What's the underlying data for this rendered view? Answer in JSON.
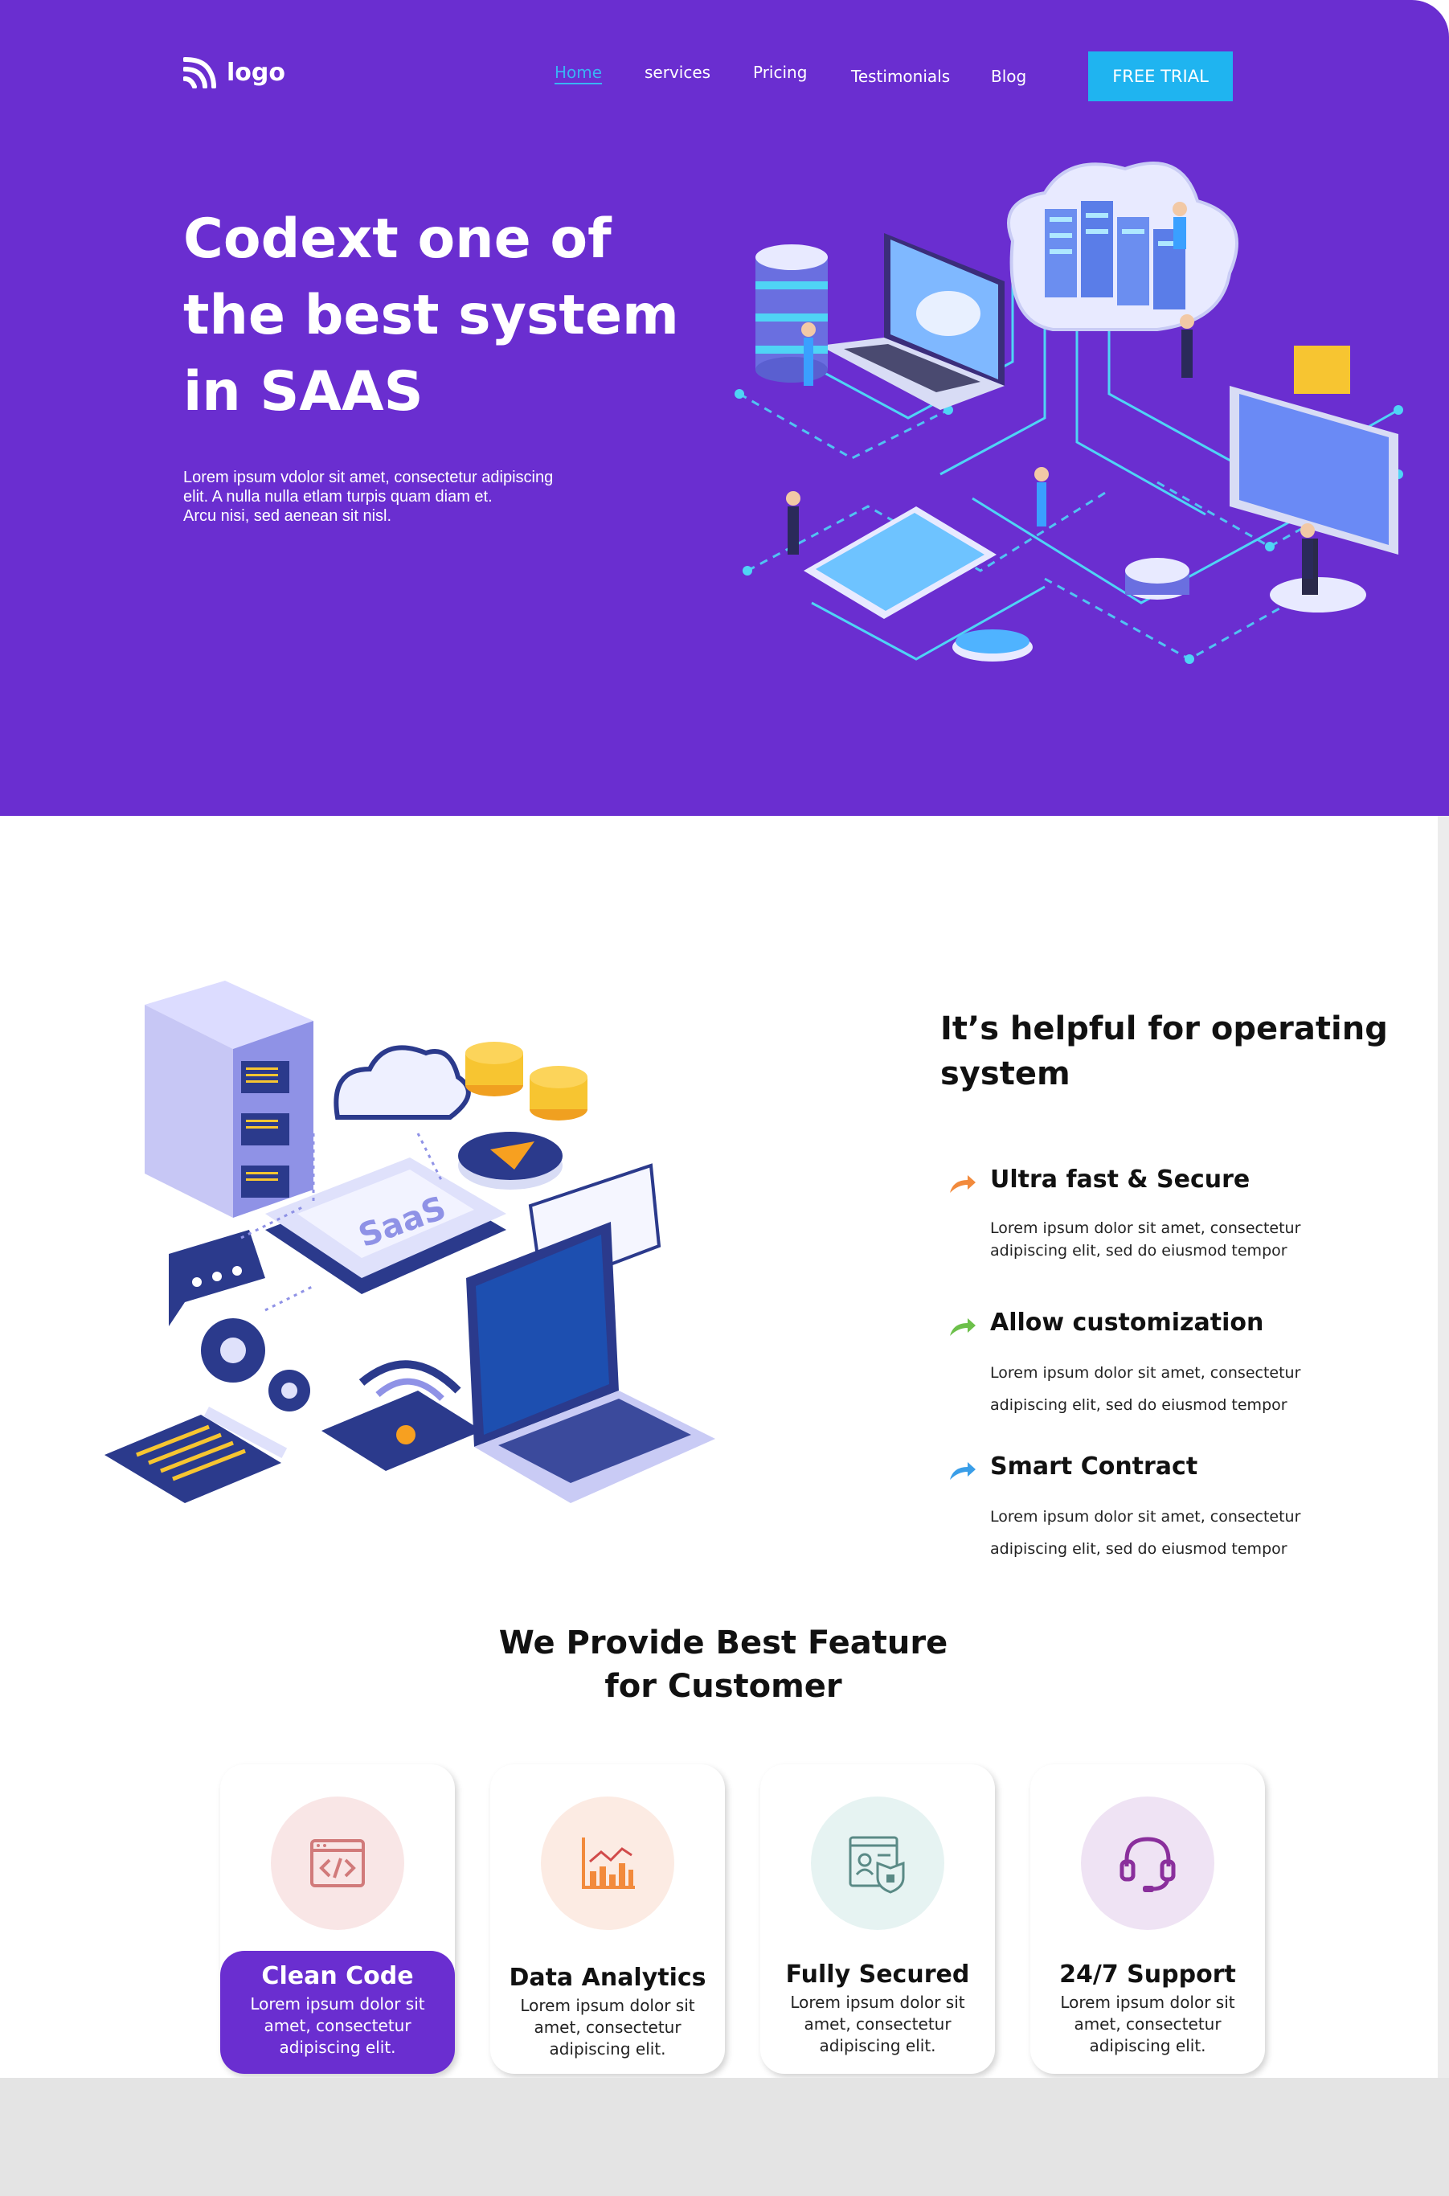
{
  "header": {
    "logo_text": "logo",
    "nav": [
      "Home",
      "services",
      "Pricing",
      "Testimonials",
      "Blog"
    ],
    "active_nav": "Home",
    "cta": "FREE TRIAL"
  },
  "hero": {
    "title_lines": [
      "Codext one of",
      "the best system",
      "in SAAS"
    ],
    "text_lines": [
      "Lorem ipsum vdolor sit amet, consectetur adipiscing",
      "elit. A nulla nulla etlam turpis quam diam et.",
      "Arcu nisi, sed aenean sit nisl."
    ]
  },
  "about": {
    "title": "It’s helpful for operating system",
    "features": [
      {
        "title": "Ultra fast & Secure",
        "text": "Lorem ipsum dolor sit amet, consectetur adipiscing elit, sed do eiusmod tempor",
        "color": "#f28a3c"
      },
      {
        "title": "Allow customization",
        "text": "Lorem ipsum dolor sit amet, consectetur adipiscing elit, sed do eiusmod tempor",
        "color": "#6cc04a"
      },
      {
        "title": "Smart Contract",
        "text": "Lorem ipsum dolor sit amet, consectetur adipiscing elit, sed do eiusmod tempor",
        "color": "#3a9ee8"
      }
    ]
  },
  "features_section": {
    "title_lines": [
      "We Provide Best Feature",
      "for Customer"
    ],
    "cards": [
      {
        "title": "Clean Code",
        "text": "Lorem ipsum dolor sit amet, consectetur adipiscing elit.",
        "icon": "code-window-icon",
        "circle_color": "#f9e6e6"
      },
      {
        "title": "Data Analytics",
        "text": "Lorem ipsum dolor sit amet, consectetur adipiscing elit.",
        "icon": "bar-chart-icon",
        "circle_color": "#fcebe3"
      },
      {
        "title": "Fully Secured",
        "text": "Lorem ipsum dolor sit amet, consectetur adipiscing elit.",
        "icon": "secure-profile-icon",
        "circle_color": "#e6f3f2"
      },
      {
        "title": "24/7 Support",
        "text": "Lorem ipsum dolor sit amet, consectetur adipiscing elit.",
        "icon": "headset-icon",
        "circle_color": "#efe3f4"
      }
    ]
  },
  "colors": {
    "brand": "#6a2ed0",
    "accent": "#1fb4f0"
  }
}
